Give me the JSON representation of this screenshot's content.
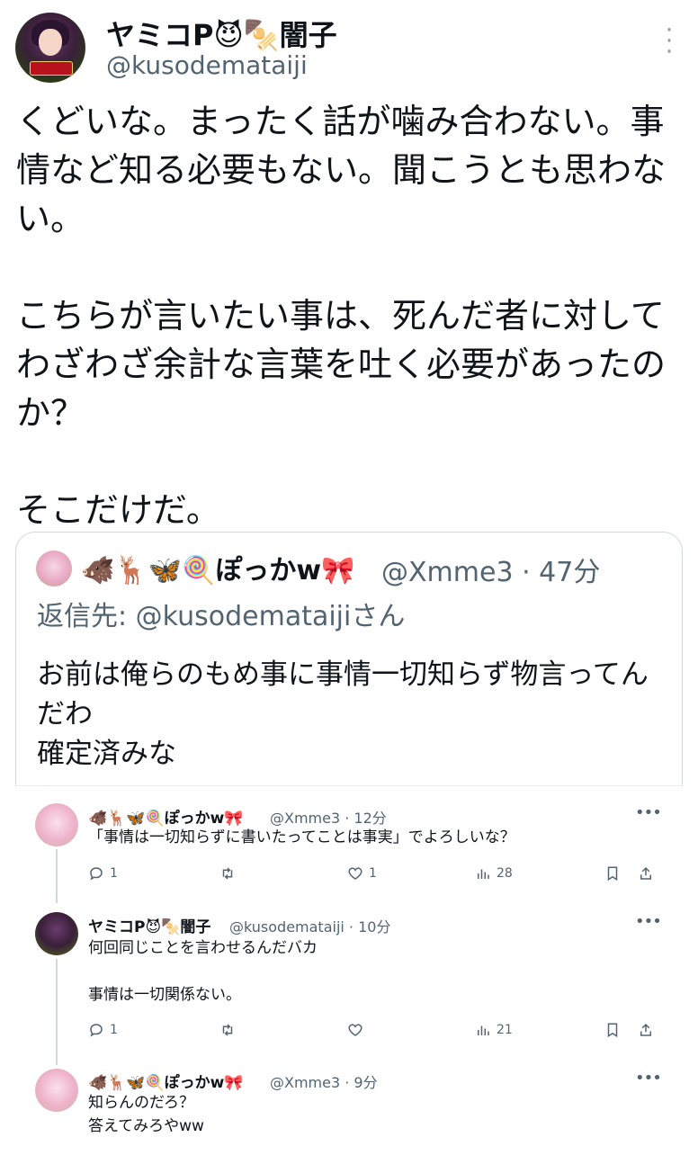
{
  "tweet": {
    "display_name": "ヤミコP😈🍢闇子",
    "handle": "@kusodemataiji",
    "body": "くどいな。まったく話が噛み合わない。事情など知る必要もない。聞こうとも思わない。\n\nこちらが言いたい事は、死んだ者に対してわざわざ余計な言葉を吐く必要があったのか？\n\nそこだけだ。"
  },
  "quote": {
    "display_name": "🐗🦌🦋🍭ぽっかw🎀",
    "handle_time": "@Xmme3 · 47分",
    "reply_to": "返信先: @kusodemataijiさん",
    "body": "お前は俺らのもめ事に事情一切知らず物言ってんだわ\n確定済みな"
  },
  "replies": [
    {
      "display_name": "🐗🦌🦋🍭ぽっかw🎀",
      "meta": "@Xmme3 · 12分",
      "text": "「事情は一切知らずに書いたってことは事実」でよろしいな？",
      "reply_count": "1",
      "retweet_count": "",
      "like_count": "1",
      "view_count": "28"
    },
    {
      "display_name": "ヤミコP😈🍢闇子",
      "meta": "@kusodemataiji · 10分",
      "text": "何回同じことを言わせるんだバカ\n\n事情は一切関係ない。",
      "reply_count": "1",
      "retweet_count": "",
      "like_count": "",
      "view_count": "21"
    },
    {
      "display_name": "🐗🦌🦋🍭ぽっかw🎀",
      "meta": "@Xmme3 · 9分",
      "text": "知らんのだろ？\n答えてみろやww"
    }
  ],
  "icons": {
    "more": "more-icon",
    "reply": "reply-icon",
    "retweet": "retweet-icon",
    "like": "heart-icon",
    "views": "views-icon",
    "bookmark": "bookmark-icon",
    "share": "share-icon"
  },
  "colors": {
    "text": "#0f1419",
    "secondary": "#536471",
    "border": "#cfd9de"
  }
}
